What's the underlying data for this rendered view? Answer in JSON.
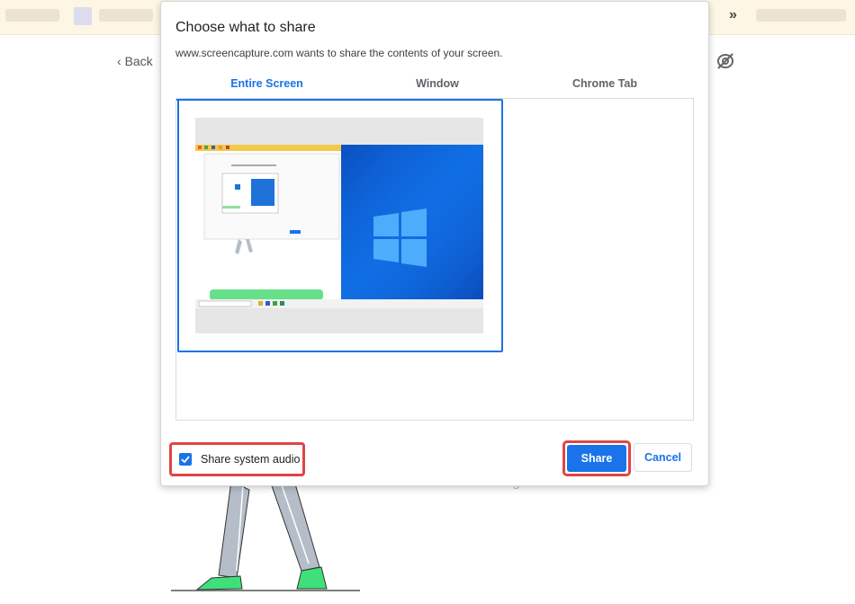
{
  "background": {
    "back_label": "Back",
    "chevron_label": "»",
    "subtext": "Start screen recording."
  },
  "dialog": {
    "title": "Choose what to share",
    "subtitle": "www.screencapture.com wants to share the contents of your screen.",
    "tabs": [
      {
        "label": "Entire Screen",
        "active": true
      },
      {
        "label": "Window",
        "active": false
      },
      {
        "label": "Chrome Tab",
        "active": false
      }
    ],
    "audio_label": "Share system audio",
    "audio_checked": true,
    "share_label": "Share",
    "cancel_label": "Cancel"
  },
  "colors": {
    "accent": "#1a73e8",
    "highlight": "#e04545",
    "desktop": "#0a5fd8"
  }
}
